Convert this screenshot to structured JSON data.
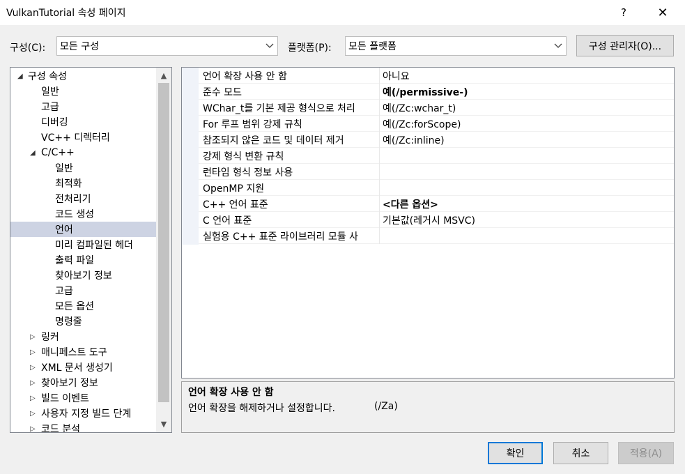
{
  "window": {
    "title": "VulkanTutorial 속성 페이지",
    "help_glyph": "?",
    "close_glyph": "✕"
  },
  "toolbar": {
    "config_label": "구성(C):",
    "config_value": "모든 구성",
    "platform_label": "플랫폼(P):",
    "platform_value": "모든 플랫폼",
    "manager_button": "구성 관리자(O)..."
  },
  "tree": {
    "items": [
      {
        "label": "구성 속성",
        "expander": "◢"
      },
      {
        "label": "일반",
        "expander": ""
      },
      {
        "label": "고급",
        "expander": ""
      },
      {
        "label": "디버깅",
        "expander": ""
      },
      {
        "label": "VC++ 디렉터리",
        "expander": ""
      },
      {
        "label": "C/C++",
        "expander": "◢"
      },
      {
        "label": "일반",
        "expander": ""
      },
      {
        "label": "최적화",
        "expander": ""
      },
      {
        "label": "전처리기",
        "expander": ""
      },
      {
        "label": "코드 생성",
        "expander": ""
      },
      {
        "label": "언어",
        "expander": ""
      },
      {
        "label": "미리 컴파일된 헤더",
        "expander": ""
      },
      {
        "label": "출력 파일",
        "expander": ""
      },
      {
        "label": "찾아보기 정보",
        "expander": ""
      },
      {
        "label": "고급",
        "expander": ""
      },
      {
        "label": "모든 옵션",
        "expander": ""
      },
      {
        "label": "명령줄",
        "expander": ""
      },
      {
        "label": "링커",
        "expander": "▷"
      },
      {
        "label": "매니페스트 도구",
        "expander": "▷"
      },
      {
        "label": "XML 문서 생성기",
        "expander": "▷"
      },
      {
        "label": "찾아보기 정보",
        "expander": "▷"
      },
      {
        "label": "빌드 이벤트",
        "expander": "▷"
      },
      {
        "label": "사용자 지정 빌드 단계",
        "expander": "▷"
      },
      {
        "label": "코드 분석",
        "expander": "▷"
      }
    ],
    "selected_index": 10,
    "scroll_up": "▲",
    "scroll_down": "▼"
  },
  "properties": [
    {
      "name": "언어 확장 사용 안 함",
      "value": "아니요",
      "bold": false
    },
    {
      "name": "준수 모드",
      "value": "예(/permissive-)",
      "bold": true
    },
    {
      "name": "WChar_t를 기본 제공 형식으로 처리",
      "value": "예(/Zc:wchar_t)",
      "bold": false
    },
    {
      "name": "For 루프 범위 강제 규칙",
      "value": "예(/Zc:forScope)",
      "bold": false
    },
    {
      "name": "참조되지 않은 코드 및 데이터 제거",
      "value": "예(/Zc:inline)",
      "bold": false
    },
    {
      "name": "강제 형식 변환 규칙",
      "value": "",
      "bold": false
    },
    {
      "name": "런타임 형식 정보 사용",
      "value": "",
      "bold": false
    },
    {
      "name": "OpenMP 지원",
      "value": "",
      "bold": false
    },
    {
      "name": "C++ 언어 표준",
      "value": "<다른 옵션>",
      "bold": true
    },
    {
      "name": "C 언어 표준",
      "value": "기본값(레거시 MSVC)",
      "bold": false
    },
    {
      "name": "실험용 C++ 표준 라이브러리 모듈 사",
      "value": "",
      "bold": false
    }
  ],
  "description": {
    "title": "언어 확장 사용 안 함",
    "text": "언어 확장을 해제하거나 설정합니다.",
    "switch": "(/Za)"
  },
  "buttons": {
    "ok": "확인",
    "cancel": "취소",
    "apply": "적용(A)"
  }
}
